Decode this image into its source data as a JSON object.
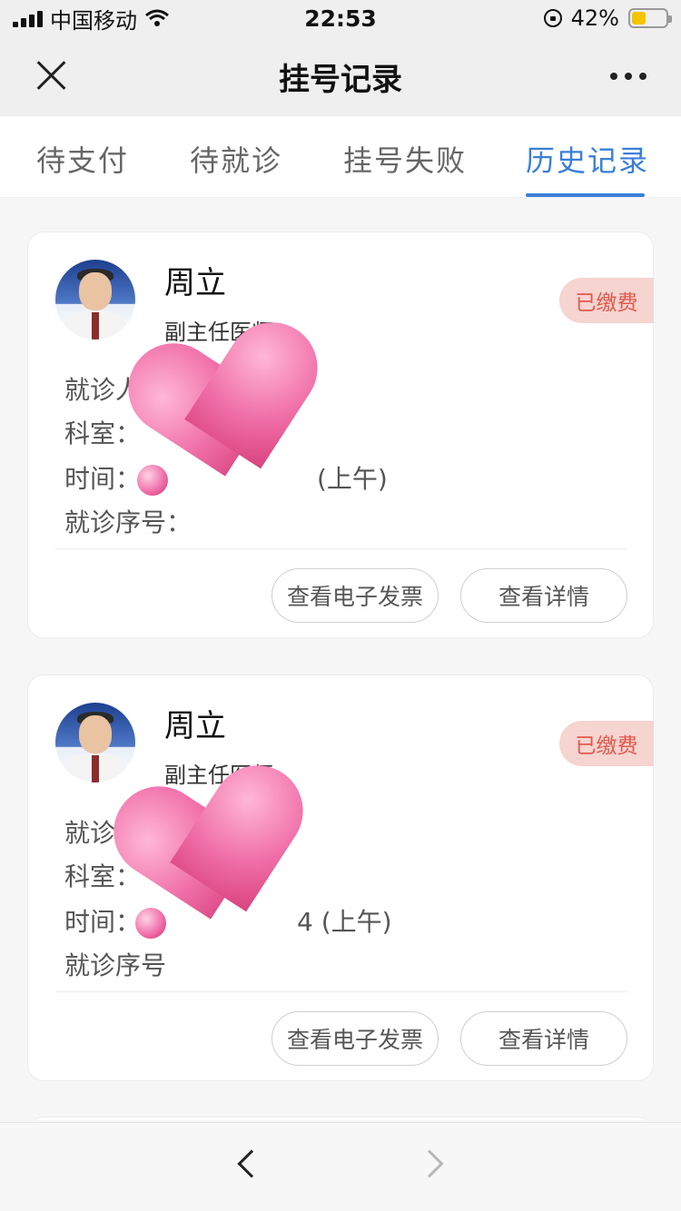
{
  "status_bar": {
    "carrier": "中国移动",
    "time": "22:53",
    "battery": "42%",
    "battery_level": 0.42,
    "icons": [
      "signal-icon",
      "wifi-icon",
      "orientation-lock-icon",
      "battery-icon"
    ]
  },
  "nav": {
    "title": "挂号记录",
    "icons": [
      "close-icon",
      "more-icon"
    ]
  },
  "tabs": [
    {
      "label": "待支付",
      "active": false
    },
    {
      "label": "待就诊",
      "active": false
    },
    {
      "label": "挂号失败",
      "active": false
    },
    {
      "label": "历史记录",
      "active": true
    }
  ],
  "accent_color": "#3a7fd8",
  "records": [
    {
      "doctor_name": "周立",
      "doctor_title": "副主任医师",
      "status": "已缴费",
      "patient_label": "就诊人",
      "department_label": "科室：",
      "time_label": "时间：",
      "time_visible": "2",
      "time_period": "(上午)",
      "sequence_label": "就诊序号：",
      "buttons": {
        "invoice": "查看电子发票",
        "detail": "查看详情"
      }
    },
    {
      "doctor_name": "周立",
      "doctor_title": "副主任医师",
      "status": "已缴费",
      "patient_label": "就诊人",
      "department_label": "科室：",
      "time_label": "时间：",
      "time_visible": "2",
      "time_suffix": "4",
      "time_period": "(上午)",
      "sequence_label": "就诊序号",
      "buttons": {
        "invoice": "查看电子发票",
        "detail": "查看详情"
      }
    }
  ],
  "bottom_bar": {
    "icons": [
      "back-icon",
      "forward-icon"
    ]
  }
}
